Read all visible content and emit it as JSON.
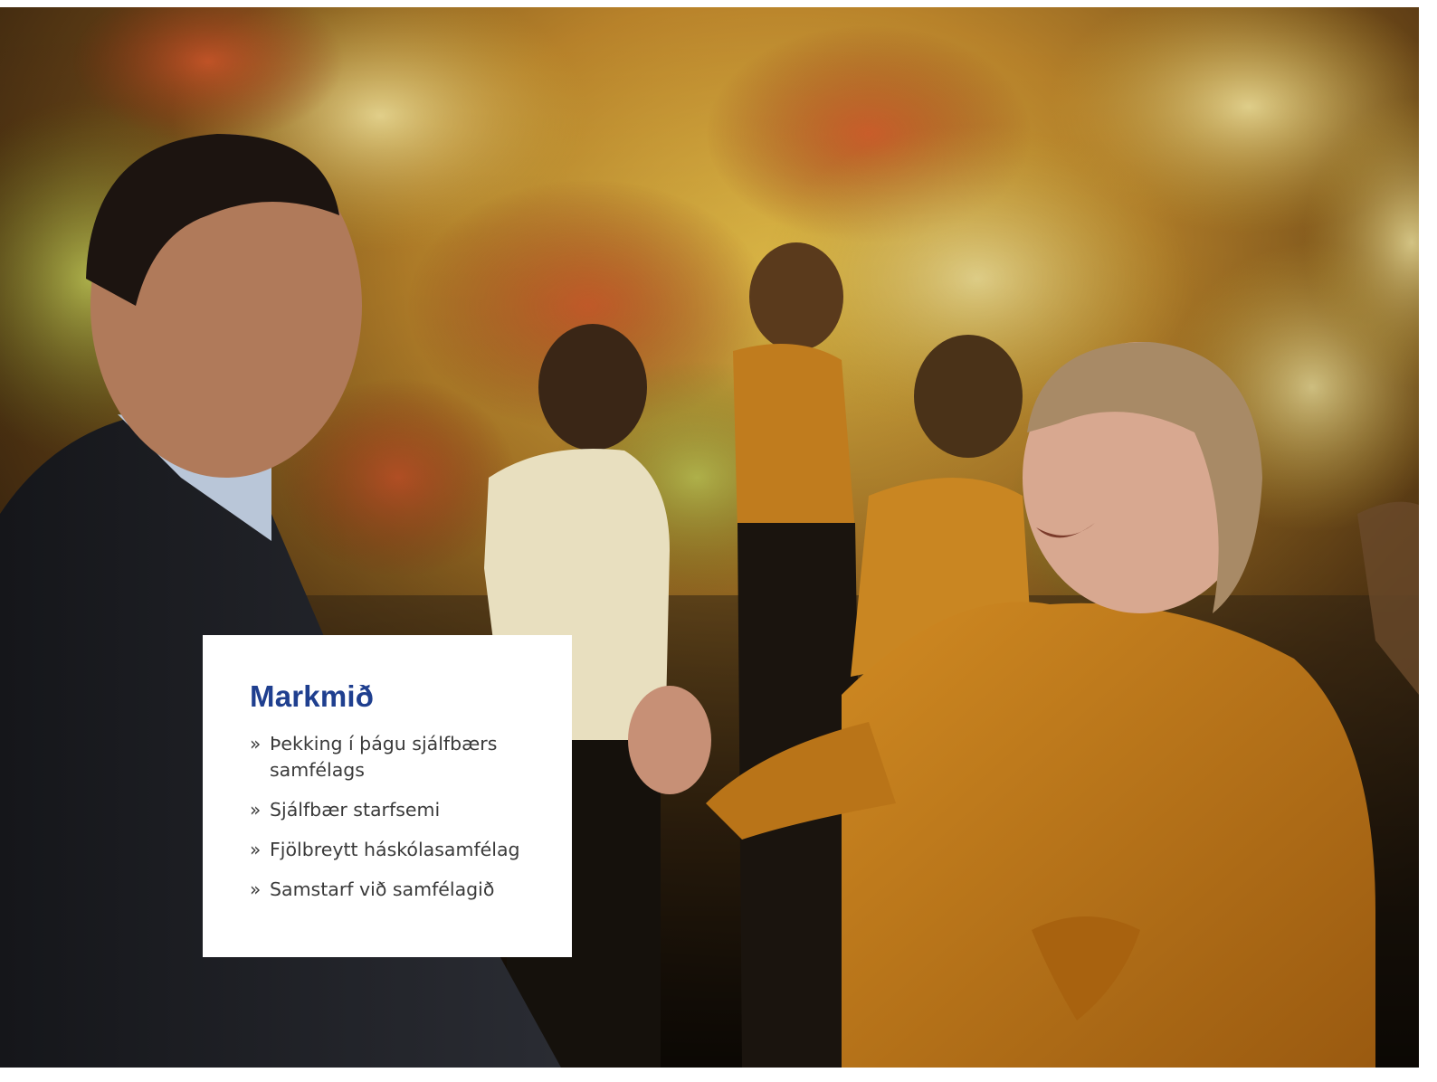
{
  "photo": {
    "description_icon": "photo-people-in-front-of-green-wall"
  },
  "card": {
    "title": "Markmið",
    "title_color": "#1f3f8f",
    "bullet": "»",
    "items": [
      "Þekking í þágu sjálfbærs samfélags",
      "Sjálfbær starfsemi",
      "Fjölbreytt háskólasamfélag",
      "Samstarf við samfélagið"
    ]
  }
}
